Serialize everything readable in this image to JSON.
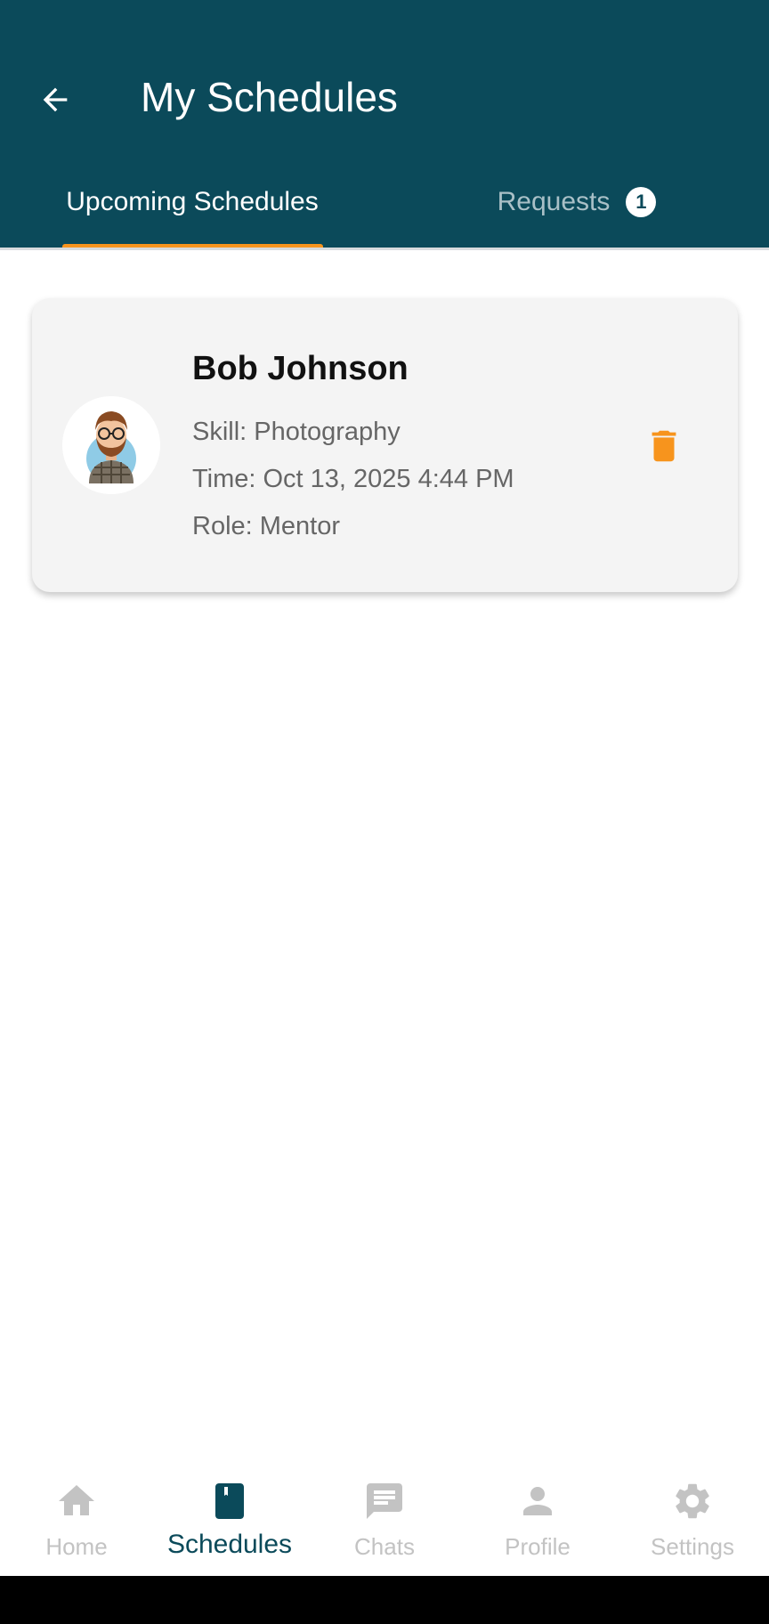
{
  "appbar": {
    "title": "My Schedules",
    "back_icon": "arrow-left-icon"
  },
  "tabs": [
    {
      "label": "Upcoming Schedules",
      "active": true
    },
    {
      "label": "Requests",
      "badge": "1",
      "active": false
    }
  ],
  "schedule_card": {
    "name": "Bob Johnson",
    "skill": "Skill: Photography",
    "time": "Time: Oct 13, 2025 4:44 PM",
    "role": "Role: Mentor",
    "avatar_icon": "user-avatar",
    "delete_icon": "trash-icon"
  },
  "bottom_nav": [
    {
      "label": "Home",
      "icon": "home-icon",
      "active": false
    },
    {
      "label": "Schedules",
      "icon": "bookmark-book-icon",
      "active": true
    },
    {
      "label": "Chats",
      "icon": "chat-icon",
      "active": false
    },
    {
      "label": "Profile",
      "icon": "person-icon",
      "active": false
    },
    {
      "label": "Settings",
      "icon": "gear-icon",
      "active": false
    }
  ],
  "colors": {
    "primary": "#0b4a5a",
    "accent": "#f7941d",
    "inactive": "#c3c3c3",
    "card_bg": "#f4f4f4"
  }
}
